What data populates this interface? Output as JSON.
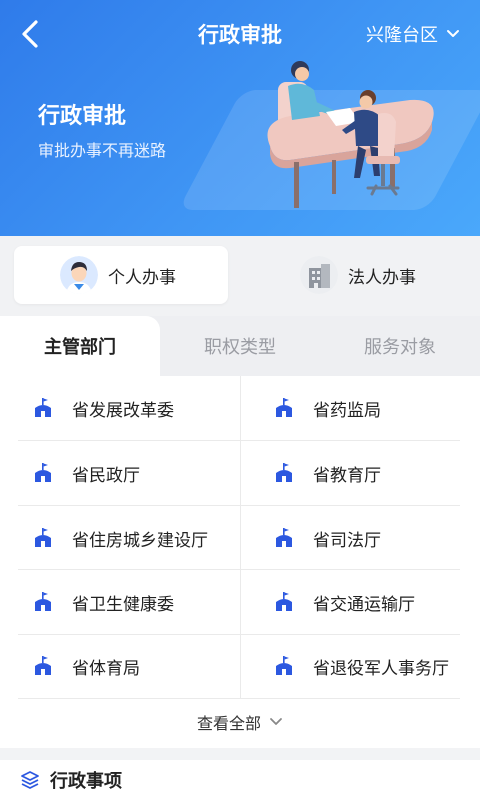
{
  "header": {
    "title": "行政审批",
    "region": "兴隆台区"
  },
  "banner": {
    "title": "行政审批",
    "subtitle": "审批办事不再迷路"
  },
  "service_types": [
    {
      "label": "个人办事",
      "icon": "person-avatar-icon",
      "selected": true
    },
    {
      "label": "法人办事",
      "icon": "building-icon",
      "selected": false
    }
  ],
  "tabs": [
    {
      "label": "主管部门",
      "selected": true
    },
    {
      "label": "职权类型",
      "selected": false
    },
    {
      "label": "服务对象",
      "selected": false
    }
  ],
  "departments": [
    "省发展改革委",
    "省药监局",
    "省民政厅",
    "省教育厅",
    "省住房城乡建设厅",
    "省司法厅",
    "省卫生健康委",
    "省交通运输厅",
    "省体育局",
    "省退役军人事务厅"
  ],
  "view_all": "查看全部",
  "section": {
    "title": "行政事项"
  },
  "colors": {
    "primary": "#2f7bea",
    "icon_blue": "#2c58e0",
    "text": "#222222",
    "muted": "#9a9ca3"
  }
}
